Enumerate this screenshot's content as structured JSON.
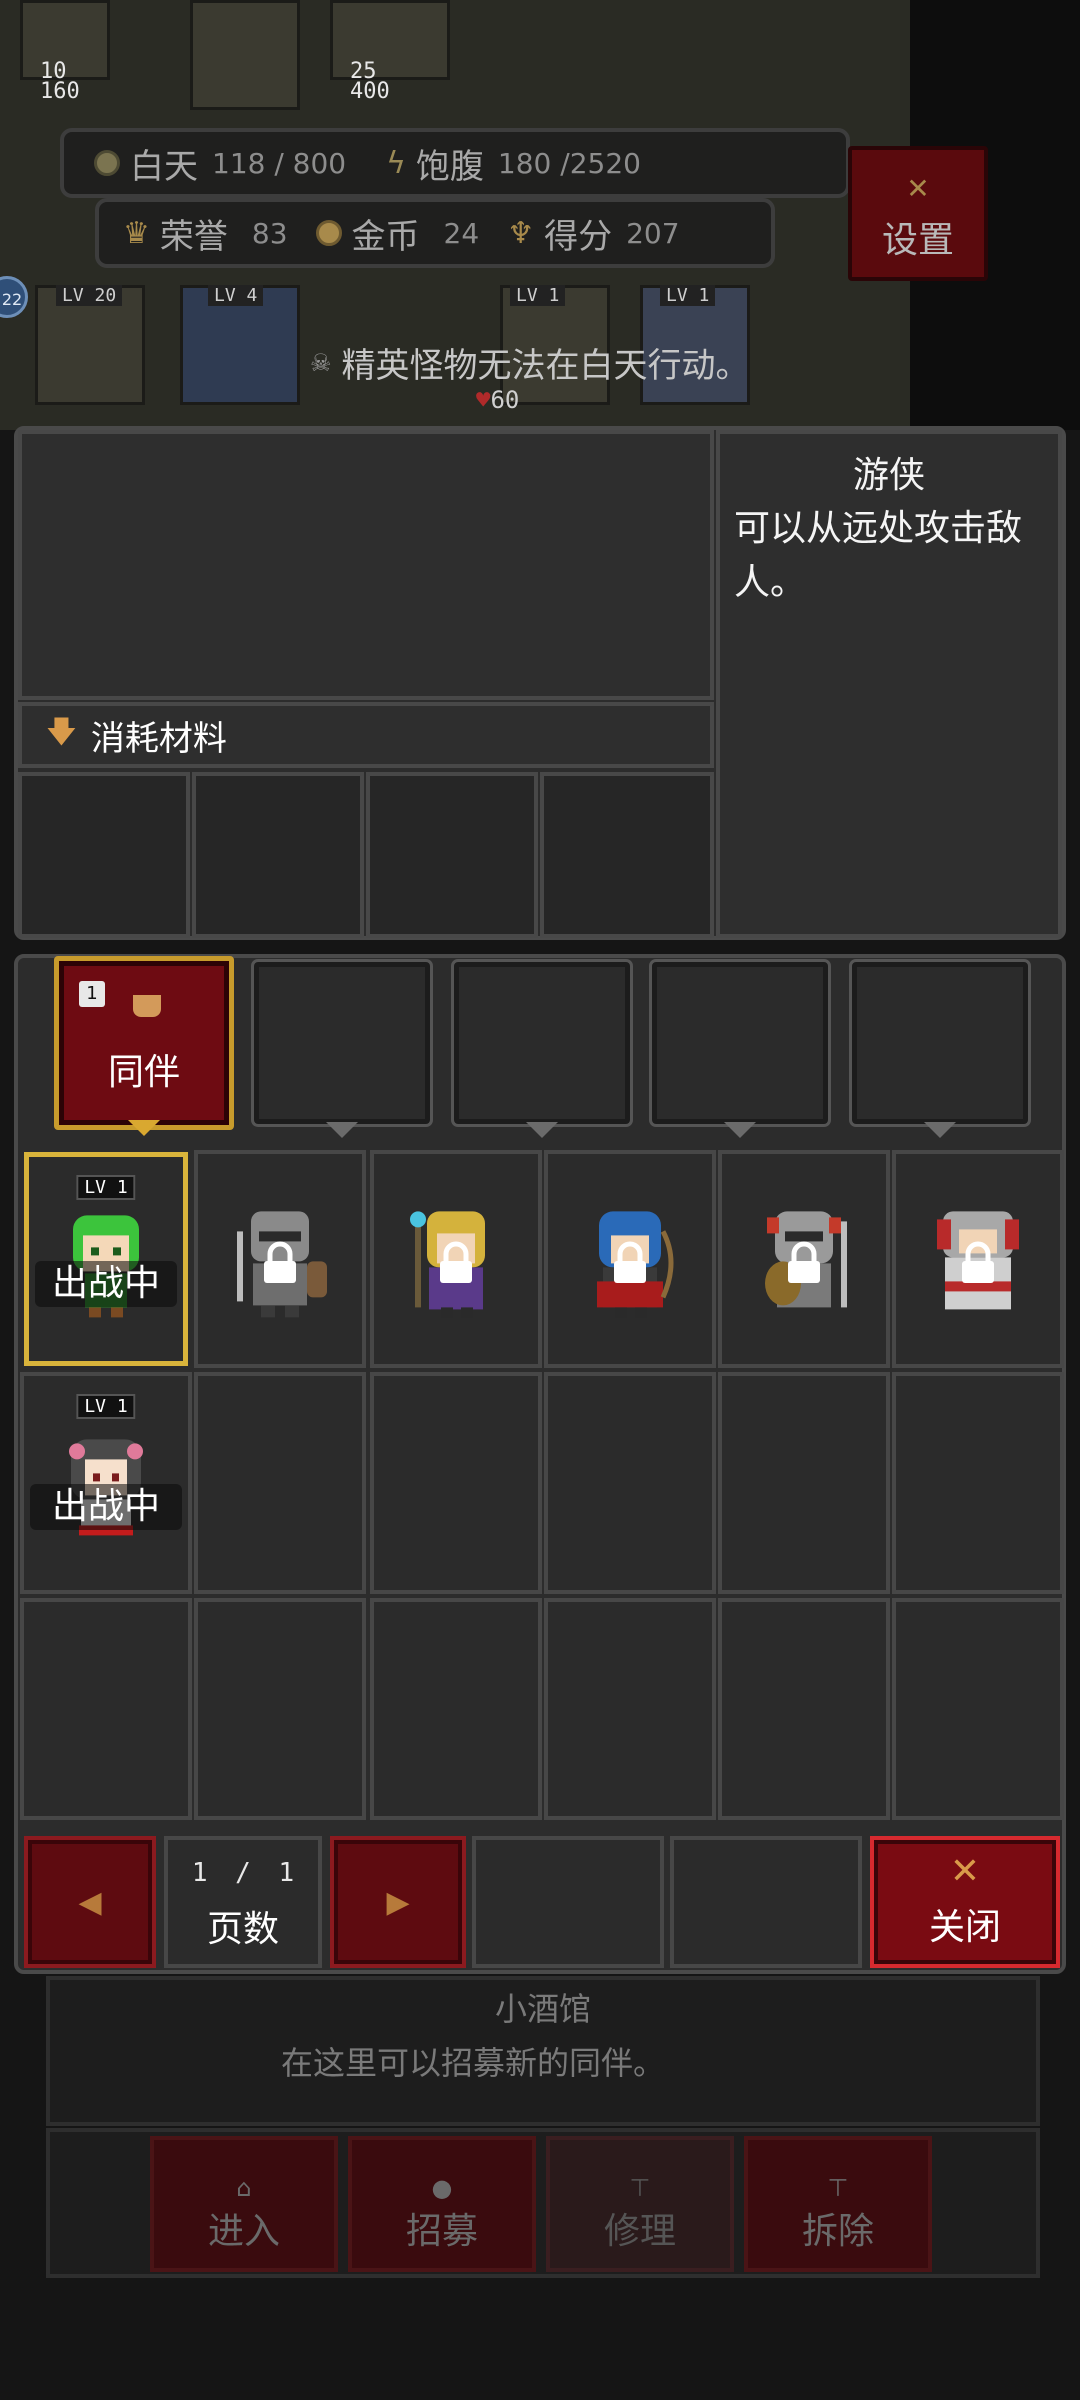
{
  "hud": {
    "day_label": "白天",
    "day_value": "118 / 800",
    "satiety_label": "饱腹",
    "satiety_value": "180 /2520",
    "honor_label": "荣誉",
    "honor_value": "83",
    "gold_label": "金币",
    "gold_value": "24",
    "score_label": "得分",
    "score_value": "207",
    "settings_label": "设置",
    "top_units": [
      "10",
      "160",
      "25",
      "400"
    ],
    "map_levels": [
      "LV 20",
      "LV 4",
      "LV 1",
      "LV 1"
    ],
    "map_hp": "60",
    "side_badge": "22"
  },
  "notice": "精英怪物无法在白天行动。",
  "info": {
    "title": "游侠",
    "description_line1": "可以从远处攻击敌",
    "description_line2": "人。",
    "materials_header": "消耗材料"
  },
  "party": {
    "slot1_count": "1",
    "slot1_label": "同伴"
  },
  "roster": {
    "hero1_level": "LV 1",
    "hero1_status": "出战中",
    "hero2_level": "LV 1",
    "hero2_status": "出战中"
  },
  "pager": {
    "current": "1",
    "separator": "/",
    "total": "1",
    "label": "页数",
    "close_label": "关闭"
  },
  "building": {
    "title": "小酒馆",
    "description": "在这里可以招募新的同伴。",
    "actions": [
      "进入",
      "招募",
      "修理",
      "拆除"
    ]
  },
  "colors": {
    "accent_red": "#7a0b12",
    "gold_border": "#d9b43b",
    "panel_bg": "#2c2c2c"
  }
}
